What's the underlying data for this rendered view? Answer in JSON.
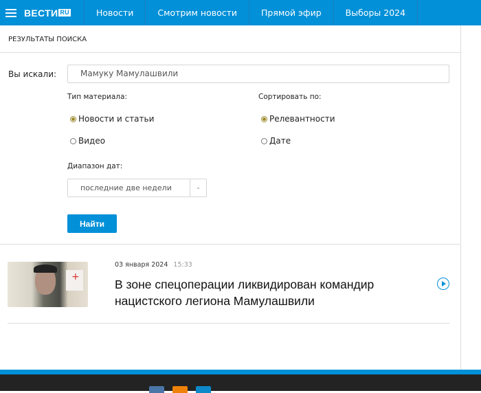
{
  "header": {
    "logo": "ВЕСТИ",
    "logo_suffix": "RU",
    "nav": [
      "Новости",
      "Смотрим новости",
      "Прямой эфир",
      "Выборы 2024"
    ]
  },
  "search": {
    "title": "РЕЗУЛЬТАТЫ ПОИСКА",
    "query_label": "Вы искали:",
    "query_value": "Мамуку Мамулашвили",
    "type_label": "Тип материала:",
    "type_options": [
      "Новости и статьи",
      "Видео"
    ],
    "sort_label": "Сортировать по:",
    "sort_options": [
      "Релевантности",
      "Дате"
    ],
    "range_label": "Диапазон дат:",
    "range_value": "последние две недели",
    "submit": "Найти"
  },
  "results": [
    {
      "date": "03 января 2024",
      "time": "15:33",
      "title": "В зоне спецоперации ликвидирован командир нацистского легиона Мамулашвили"
    }
  ],
  "colors": {
    "brand": "#0290d8",
    "radio": "#9b8a2a",
    "footer": "#232323"
  }
}
